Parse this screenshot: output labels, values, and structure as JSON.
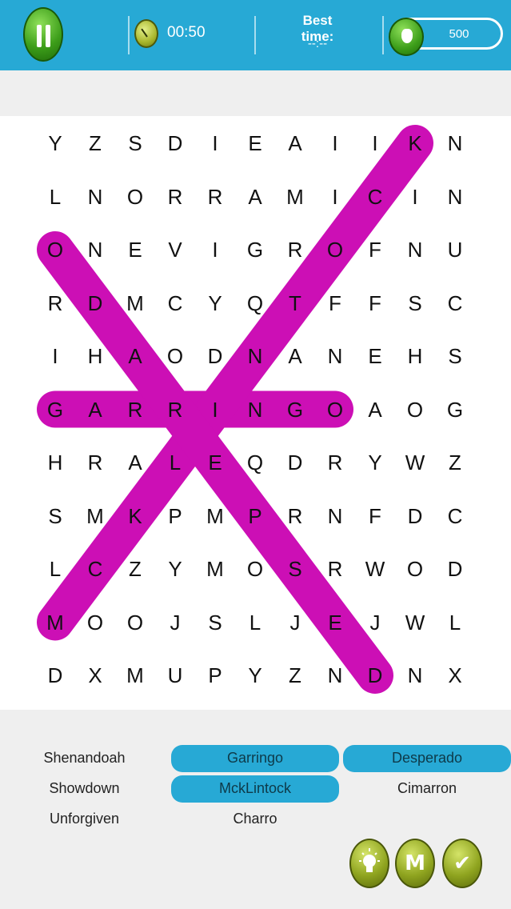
{
  "header": {
    "timer": "00:50",
    "best_time_label": "Best time:",
    "best_time_value": "--:--",
    "coins": "500"
  },
  "grid": [
    [
      "Y",
      "Z",
      "S",
      "D",
      "I",
      "E",
      "A",
      "I",
      "I",
      "K",
      "N"
    ],
    [
      "L",
      "N",
      "O",
      "R",
      "R",
      "A",
      "M",
      "I",
      "C",
      "I",
      "N"
    ],
    [
      "O",
      "N",
      "E",
      "V",
      "I",
      "G",
      "R",
      "O",
      "F",
      "N",
      "U"
    ],
    [
      "R",
      "D",
      "M",
      "C",
      "Y",
      "Q",
      "T",
      "F",
      "F",
      "S",
      "C"
    ],
    [
      "I",
      "H",
      "A",
      "O",
      "D",
      "N",
      "A",
      "N",
      "E",
      "H",
      "S"
    ],
    [
      "G",
      "A",
      "R",
      "R",
      "I",
      "N",
      "G",
      "O",
      "A",
      "O",
      "G"
    ],
    [
      "H",
      "R",
      "A",
      "L",
      "E",
      "Q",
      "D",
      "R",
      "Y",
      "W",
      "Z"
    ],
    [
      "S",
      "M",
      "K",
      "P",
      "M",
      "P",
      "R",
      "N",
      "F",
      "D",
      "C"
    ],
    [
      "L",
      "C",
      "Z",
      "Y",
      "M",
      "O",
      "S",
      "R",
      "W",
      "O",
      "D"
    ],
    [
      "M",
      "O",
      "O",
      "J",
      "S",
      "L",
      "J",
      "E",
      "J",
      "W",
      "L"
    ],
    [
      "D",
      "X",
      "M",
      "U",
      "P",
      "Y",
      "Z",
      "N",
      "D",
      "N",
      "X"
    ]
  ],
  "found_highlights": [
    {
      "word": "Garringo",
      "from": [
        5,
        0
      ],
      "to": [
        5,
        7
      ]
    },
    {
      "word": "McKlintock",
      "from": [
        0,
        9
      ],
      "to": [
        9,
        0
      ]
    },
    {
      "word": "Desperado",
      "from": [
        2,
        0
      ],
      "to": [
        10,
        8
      ]
    }
  ],
  "highlight_color": "#cc0fb5",
  "words": [
    {
      "label": "Shenandoah",
      "found": false
    },
    {
      "label": "Garringo",
      "found": true
    },
    {
      "label": "Desperado",
      "found": true
    },
    {
      "label": "Showdown",
      "found": false
    },
    {
      "label": "MckLintock",
      "found": true
    },
    {
      "label": "Cimarron",
      "found": false
    },
    {
      "label": "Unforgiven",
      "found": false
    },
    {
      "label": "Charro",
      "found": false
    }
  ],
  "buttons": [
    {
      "icon": "lightbulb-icon"
    },
    {
      "icon": "m-letter-icon",
      "label": "M"
    },
    {
      "icon": "checkmark-icon",
      "label": "✔"
    }
  ]
}
